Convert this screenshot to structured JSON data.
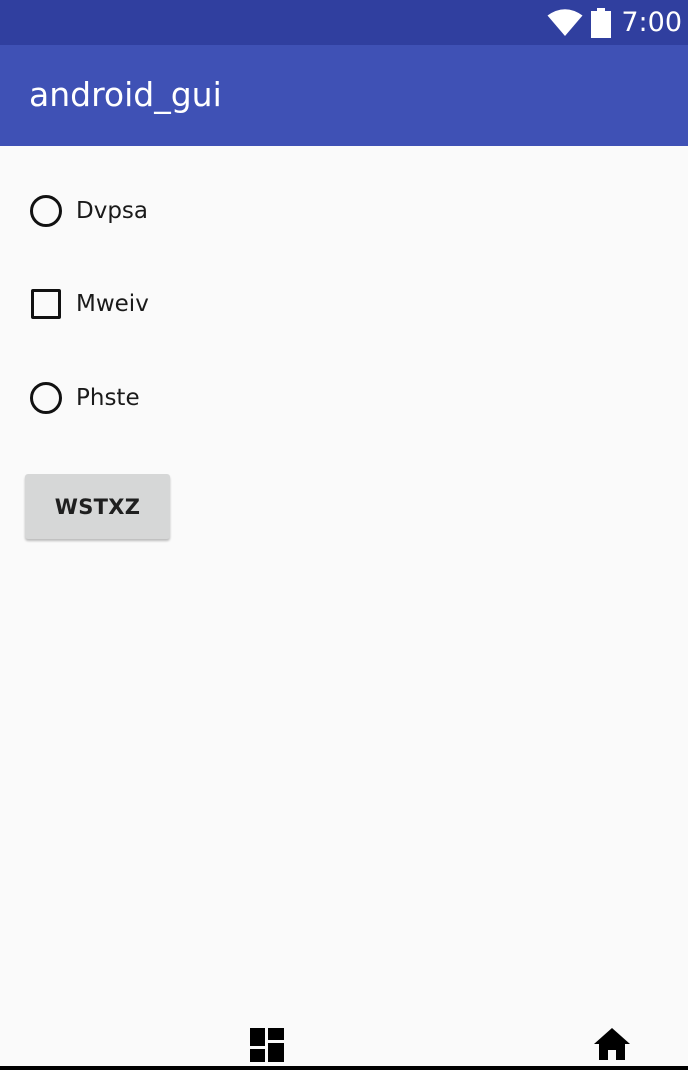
{
  "status_bar": {
    "time": "7:00",
    "icons": [
      "wifi-icon",
      "battery-icon"
    ]
  },
  "app_bar": {
    "title": "android_gui"
  },
  "options": [
    {
      "type": "radio",
      "label": "Dvpsa",
      "checked": false
    },
    {
      "type": "checkbox",
      "label": "Mweiv",
      "checked": false
    },
    {
      "type": "radio",
      "label": "Phste",
      "checked": false
    }
  ],
  "button": {
    "label": "WSTXZ"
  },
  "nav_bar": {
    "icons": [
      "dashboard-icon",
      "home-icon"
    ]
  },
  "colors": {
    "status_bar": "#303f9f",
    "app_bar": "#3f51b5",
    "background": "#fafafa",
    "button": "#d6d7d7"
  }
}
